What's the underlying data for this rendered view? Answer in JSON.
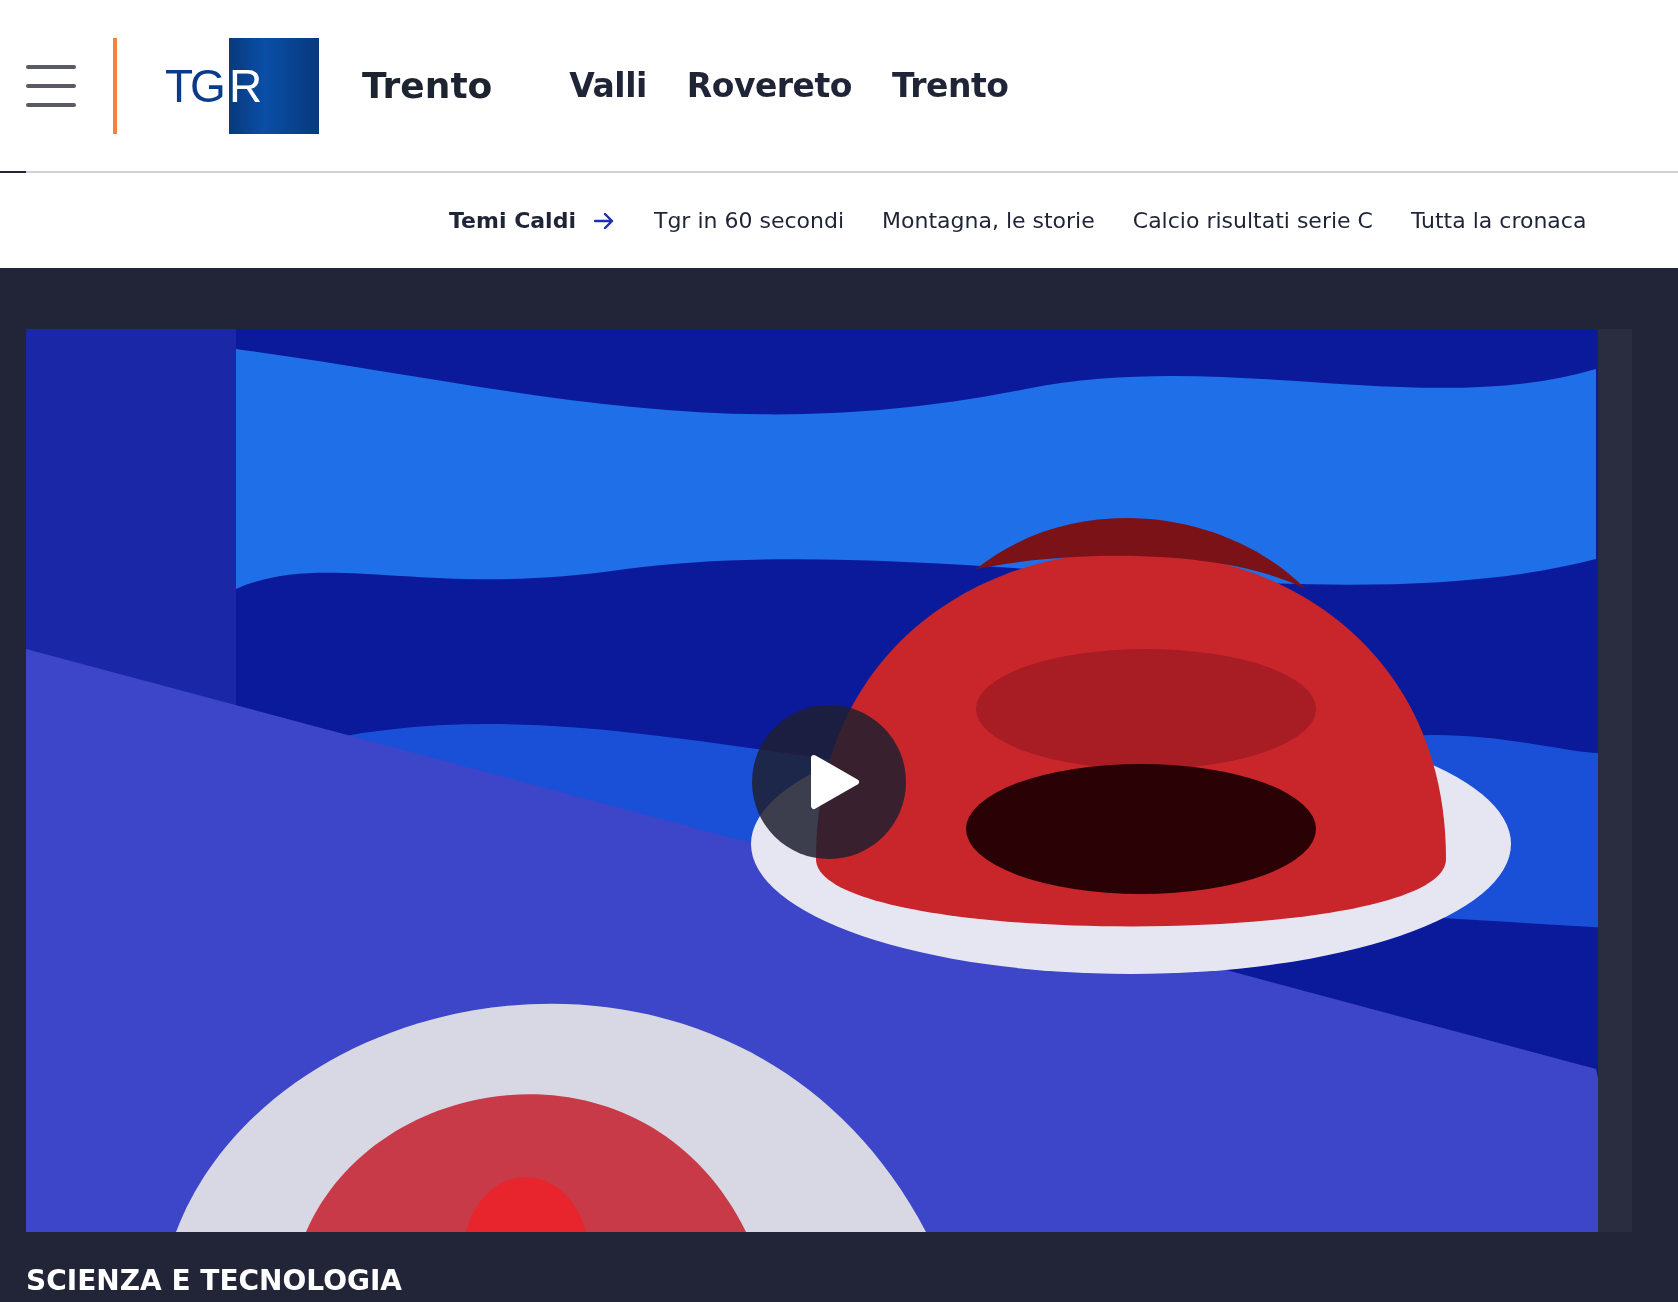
{
  "header": {
    "logo": "TGR",
    "region": "Trento",
    "links": [
      {
        "label": "Valli"
      },
      {
        "label": "Rovereto"
      },
      {
        "label": "Trento"
      }
    ]
  },
  "topics": {
    "title": "Temi Caldi",
    "items": [
      {
        "label": "Tgr in 60 secondi"
      },
      {
        "label": "Montagna, le storie"
      },
      {
        "label": "Calcio risultati serie C"
      },
      {
        "label": "Tutta la cronaca"
      }
    ]
  },
  "section": {
    "title": "SCIENZA E TECNOLOGIA"
  }
}
